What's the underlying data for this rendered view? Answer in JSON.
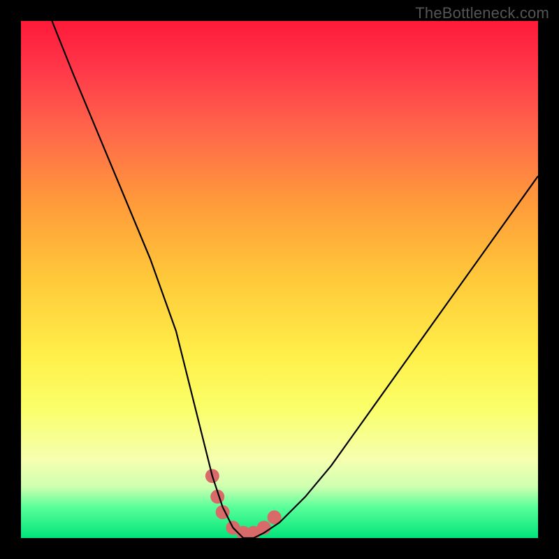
{
  "watermark": {
    "text": "TheBottleneck.com"
  },
  "chart_data": {
    "type": "line",
    "title": "",
    "xlabel": "",
    "ylabel": "",
    "xlim": [
      0,
      100
    ],
    "ylim": [
      0,
      100
    ],
    "series": [
      {
        "name": "bottleneck-curve",
        "x": [
          6,
          10,
          15,
          20,
          25,
          30,
          33,
          35,
          37,
          39,
          41,
          43,
          45,
          47,
          50,
          55,
          60,
          65,
          70,
          75,
          80,
          85,
          90,
          95,
          100
        ],
        "values": [
          100,
          90,
          78,
          66,
          54,
          40,
          28,
          20,
          12,
          6,
          2,
          0,
          0,
          1,
          3,
          8,
          14,
          21,
          28,
          35,
          42,
          49,
          56,
          63,
          70
        ]
      }
    ],
    "markers": {
      "name": "trough-points",
      "color": "#d96a6a",
      "points": [
        {
          "x": 37,
          "y": 12
        },
        {
          "x": 38,
          "y": 8
        },
        {
          "x": 39,
          "y": 5
        },
        {
          "x": 41,
          "y": 2
        },
        {
          "x": 43,
          "y": 1
        },
        {
          "x": 45,
          "y": 1
        },
        {
          "x": 47,
          "y": 2
        },
        {
          "x": 49,
          "y": 4
        }
      ],
      "radius": 10
    }
  }
}
